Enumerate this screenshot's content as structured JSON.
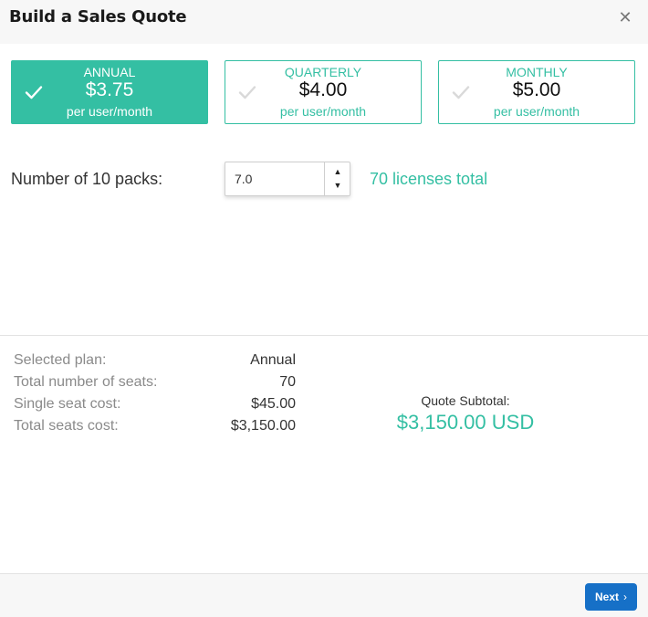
{
  "dialog": {
    "title": "Build a Sales Quote",
    "close_icon": "close-icon",
    "close_glyph": "✕"
  },
  "plans": [
    {
      "name": "ANNUAL",
      "price": "$3.75",
      "unit": "per user/month",
      "selected": true
    },
    {
      "name": "QUARTERLY",
      "price": "$4.00",
      "unit": "per user/month",
      "selected": false
    },
    {
      "name": "MONTHLY",
      "price": "$5.00",
      "unit": "per user/month",
      "selected": false
    }
  ],
  "packs": {
    "label": "Number of 10 packs:",
    "value": "7.0",
    "up_glyph": "▲",
    "down_glyph": "▼",
    "licenses_text": "70 licenses total"
  },
  "summary": {
    "rows": [
      {
        "label": "Selected plan:",
        "value": "Annual"
      },
      {
        "label": "Total number of seats:",
        "value": "70"
      },
      {
        "label": "Single seat cost:",
        "value": "$45.00"
      },
      {
        "label": "Total seats cost:",
        "value": "$3,150.00"
      }
    ],
    "subtotal_label": "Quote Subtotal:",
    "subtotal_value": "$3,150.00 USD"
  },
  "footer": {
    "next_label": "Next",
    "next_glyph": "›"
  },
  "colors": {
    "accent": "#34bfa3",
    "primary_button": "#1670c7",
    "header_bg": "#f7f7f7"
  }
}
